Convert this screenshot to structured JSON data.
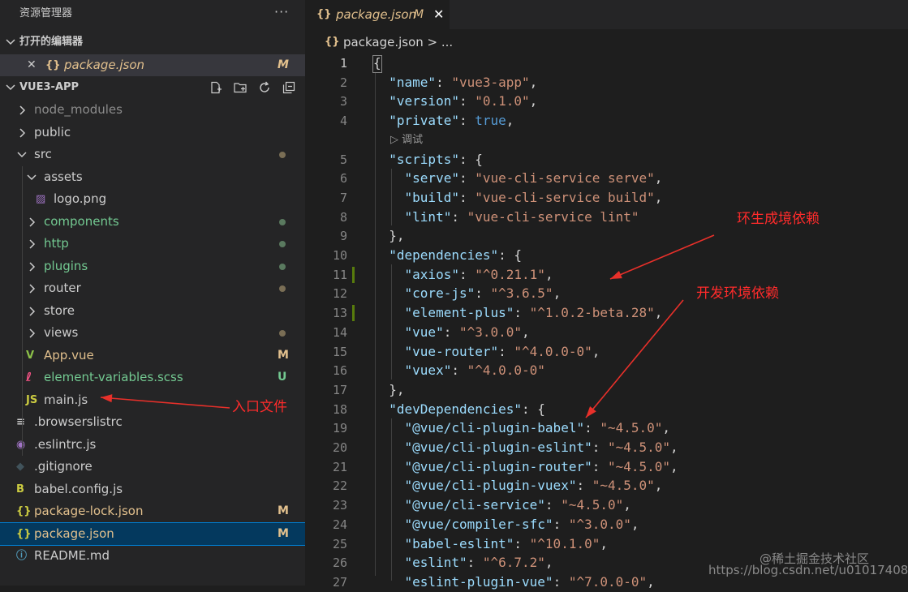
{
  "sidebar": {
    "title": "资源管理器",
    "more": "···",
    "open_editors_label": "打开的编辑器",
    "open_editor": {
      "close": "✕",
      "icon": "{}",
      "name": "package.json",
      "badge": "M"
    },
    "project_label": "VUE3-APP",
    "tree": [
      {
        "label": "node_modules",
        "type": "folder",
        "depth": 1,
        "color": "#8c8c8c",
        "badge": "",
        "dot": ""
      },
      {
        "label": "public",
        "type": "folder",
        "depth": 1,
        "color": "#cccccc",
        "badge": "",
        "dot": ""
      },
      {
        "label": "src",
        "type": "folder-open",
        "depth": 1,
        "color": "#cccccc",
        "badge": "",
        "dot": "#7a6e55"
      },
      {
        "label": "assets",
        "type": "folder-open",
        "depth": 2,
        "color": "#cccccc",
        "badge": "",
        "dot": ""
      },
      {
        "label": "logo.png",
        "type": "image",
        "depth": 3,
        "color": "#cccccc",
        "badge": "",
        "dot": ""
      },
      {
        "label": "components",
        "type": "folder",
        "depth": 2,
        "color": "#73c991",
        "badge": "",
        "dot": "#5a7a5f"
      },
      {
        "label": "http",
        "type": "folder",
        "depth": 2,
        "color": "#73c991",
        "badge": "",
        "dot": "#5a7a5f"
      },
      {
        "label": "plugins",
        "type": "folder",
        "depth": 2,
        "color": "#73c991",
        "badge": "",
        "dot": "#5a7a5f"
      },
      {
        "label": "router",
        "type": "folder",
        "depth": 2,
        "color": "#cccccc",
        "badge": "",
        "dot": "#7a6e55"
      },
      {
        "label": "store",
        "type": "folder",
        "depth": 2,
        "color": "#cccccc",
        "badge": "",
        "dot": ""
      },
      {
        "label": "views",
        "type": "folder",
        "depth": 2,
        "color": "#cccccc",
        "badge": "",
        "dot": "#7a6e55"
      },
      {
        "label": "App.vue",
        "type": "vue",
        "depth": 2,
        "color": "#e2c08d",
        "badge": "M",
        "dot": ""
      },
      {
        "label": "element-variables.scss",
        "type": "scss",
        "depth": 2,
        "color": "#73c991",
        "badge": "U",
        "dot": ""
      },
      {
        "label": "main.js",
        "type": "js",
        "depth": 2,
        "color": "#cccccc",
        "badge": "",
        "dot": ""
      },
      {
        "label": ".browserslistrc",
        "type": "lines",
        "depth": 1,
        "color": "#cccccc",
        "badge": "",
        "dot": ""
      },
      {
        "label": ".eslintrc.js",
        "type": "eslint",
        "depth": 1,
        "color": "#cccccc",
        "badge": "",
        "dot": ""
      },
      {
        "label": ".gitignore",
        "type": "git",
        "depth": 1,
        "color": "#cccccc",
        "badge": "",
        "dot": ""
      },
      {
        "label": "babel.config.js",
        "type": "babel",
        "depth": 1,
        "color": "#cccccc",
        "badge": "",
        "dot": ""
      },
      {
        "label": "package-lock.json",
        "type": "json",
        "depth": 1,
        "color": "#e2c08d",
        "badge": "M",
        "dot": ""
      },
      {
        "label": "package.json",
        "type": "json",
        "depth": 1,
        "color": "#e2c08d",
        "badge": "M",
        "dot": "",
        "selected": true
      },
      {
        "label": "README.md",
        "type": "info",
        "depth": 1,
        "color": "#cccccc",
        "badge": "",
        "dot": ""
      }
    ]
  },
  "editor": {
    "tab": {
      "icon": "{}",
      "name": "package.json",
      "badge": "M",
      "close": "✕"
    },
    "breadcrumb": {
      "icon": "{}",
      "path": "package.json > ..."
    },
    "codelens": "▷ 调试",
    "lines": [
      {
        "n": "1",
        "t": [
          [
            "p",
            "{"
          ]
        ]
      },
      {
        "n": "2",
        "t": [
          [
            "p",
            "  "
          ],
          [
            "k",
            "\"name\""
          ],
          [
            "p",
            ": "
          ],
          [
            "s",
            "\"vue3-app\""
          ],
          [
            "p",
            ","
          ]
        ]
      },
      {
        "n": "3",
        "t": [
          [
            "p",
            "  "
          ],
          [
            "k",
            "\"version\""
          ],
          [
            "p",
            ": "
          ],
          [
            "s",
            "\"0.1.0\""
          ],
          [
            "p",
            ","
          ]
        ]
      },
      {
        "n": "4",
        "t": [
          [
            "p",
            "  "
          ],
          [
            "k",
            "\"private\""
          ],
          [
            "p",
            ": "
          ],
          [
            "kw",
            "true"
          ],
          [
            "p",
            ","
          ]
        ]
      },
      {
        "n": "5",
        "t": [
          [
            "p",
            "  "
          ],
          [
            "k",
            "\"scripts\""
          ],
          [
            "p",
            ": {"
          ]
        ]
      },
      {
        "n": "6",
        "t": [
          [
            "p",
            "    "
          ],
          [
            "k",
            "\"serve\""
          ],
          [
            "p",
            ": "
          ],
          [
            "s",
            "\"vue-cli-service serve\""
          ],
          [
            "p",
            ","
          ]
        ]
      },
      {
        "n": "7",
        "t": [
          [
            "p",
            "    "
          ],
          [
            "k",
            "\"build\""
          ],
          [
            "p",
            ": "
          ],
          [
            "s",
            "\"vue-cli-service build\""
          ],
          [
            "p",
            ","
          ]
        ]
      },
      {
        "n": "8",
        "t": [
          [
            "p",
            "    "
          ],
          [
            "k",
            "\"lint\""
          ],
          [
            "p",
            ": "
          ],
          [
            "s",
            "\"vue-cli-service lint\""
          ]
        ]
      },
      {
        "n": "9",
        "t": [
          [
            "p",
            "  },"
          ]
        ]
      },
      {
        "n": "10",
        "t": [
          [
            "p",
            "  "
          ],
          [
            "k",
            "\"dependencies\""
          ],
          [
            "p",
            ": {"
          ]
        ]
      },
      {
        "n": "11",
        "t": [
          [
            "p",
            "    "
          ],
          [
            "k",
            "\"axios\""
          ],
          [
            "p",
            ": "
          ],
          [
            "s",
            "\"^0.21.1\""
          ],
          [
            "p",
            ","
          ]
        ],
        "mark": true
      },
      {
        "n": "12",
        "t": [
          [
            "p",
            "    "
          ],
          [
            "k",
            "\"core-js\""
          ],
          [
            "p",
            ": "
          ],
          [
            "s",
            "\"^3.6.5\""
          ],
          [
            "p",
            ","
          ]
        ]
      },
      {
        "n": "13",
        "t": [
          [
            "p",
            "    "
          ],
          [
            "k",
            "\"element-plus\""
          ],
          [
            "p",
            ": "
          ],
          [
            "s",
            "\"^1.0.2-beta.28\""
          ],
          [
            "p",
            ","
          ]
        ],
        "mark": true
      },
      {
        "n": "14",
        "t": [
          [
            "p",
            "    "
          ],
          [
            "k",
            "\"vue\""
          ],
          [
            "p",
            ": "
          ],
          [
            "s",
            "\"^3.0.0\""
          ],
          [
            "p",
            ","
          ]
        ]
      },
      {
        "n": "15",
        "t": [
          [
            "p",
            "    "
          ],
          [
            "k",
            "\"vue-router\""
          ],
          [
            "p",
            ": "
          ],
          [
            "s",
            "\"^4.0.0-0\""
          ],
          [
            "p",
            ","
          ]
        ]
      },
      {
        "n": "16",
        "t": [
          [
            "p",
            "    "
          ],
          [
            "k",
            "\"vuex\""
          ],
          [
            "p",
            ": "
          ],
          [
            "s",
            "\"^4.0.0-0\""
          ]
        ]
      },
      {
        "n": "17",
        "t": [
          [
            "p",
            "  },"
          ]
        ]
      },
      {
        "n": "18",
        "t": [
          [
            "p",
            "  "
          ],
          [
            "k",
            "\"devDependencies\""
          ],
          [
            "p",
            ": {"
          ]
        ]
      },
      {
        "n": "19",
        "t": [
          [
            "p",
            "    "
          ],
          [
            "k",
            "\"@vue/cli-plugin-babel\""
          ],
          [
            "p",
            ": "
          ],
          [
            "s",
            "\"~4.5.0\""
          ],
          [
            "p",
            ","
          ]
        ]
      },
      {
        "n": "20",
        "t": [
          [
            "p",
            "    "
          ],
          [
            "k",
            "\"@vue/cli-plugin-eslint\""
          ],
          [
            "p",
            ": "
          ],
          [
            "s",
            "\"~4.5.0\""
          ],
          [
            "p",
            ","
          ]
        ]
      },
      {
        "n": "21",
        "t": [
          [
            "p",
            "    "
          ],
          [
            "k",
            "\"@vue/cli-plugin-router\""
          ],
          [
            "p",
            ": "
          ],
          [
            "s",
            "\"~4.5.0\""
          ],
          [
            "p",
            ","
          ]
        ]
      },
      {
        "n": "22",
        "t": [
          [
            "p",
            "    "
          ],
          [
            "k",
            "\"@vue/cli-plugin-vuex\""
          ],
          [
            "p",
            ": "
          ],
          [
            "s",
            "\"~4.5.0\""
          ],
          [
            "p",
            ","
          ]
        ]
      },
      {
        "n": "23",
        "t": [
          [
            "p",
            "    "
          ],
          [
            "k",
            "\"@vue/cli-service\""
          ],
          [
            "p",
            ": "
          ],
          [
            "s",
            "\"~4.5.0\""
          ],
          [
            "p",
            ","
          ]
        ]
      },
      {
        "n": "24",
        "t": [
          [
            "p",
            "    "
          ],
          [
            "k",
            "\"@vue/compiler-sfc\""
          ],
          [
            "p",
            ": "
          ],
          [
            "s",
            "\"^3.0.0\""
          ],
          [
            "p",
            ","
          ]
        ]
      },
      {
        "n": "25",
        "t": [
          [
            "p",
            "    "
          ],
          [
            "k",
            "\"babel-eslint\""
          ],
          [
            "p",
            ": "
          ],
          [
            "s",
            "\"^10.1.0\""
          ],
          [
            "p",
            ","
          ]
        ]
      },
      {
        "n": "26",
        "t": [
          [
            "p",
            "    "
          ],
          [
            "k",
            "\"eslint\""
          ],
          [
            "p",
            ": "
          ],
          [
            "s",
            "\"^6.7.2\""
          ],
          [
            "p",
            ","
          ]
        ]
      },
      {
        "n": "27",
        "t": [
          [
            "p",
            "    "
          ],
          [
            "k",
            "\"eslint-plugin-vue\""
          ],
          [
            "p",
            ": "
          ],
          [
            "s",
            "\"^7.0.0-0\""
          ],
          [
            "p",
            ","
          ]
        ]
      }
    ]
  },
  "annotations": {
    "prod_deps": "环生成境依赖",
    "dev_deps": "开发环境依赖",
    "entry": "入口文件",
    "arrow_color": "#e8302a"
  },
  "watermark": {
    "line1": "@稀土掘金技术社区",
    "line2": "https://blog.csdn.net/u010174083"
  }
}
